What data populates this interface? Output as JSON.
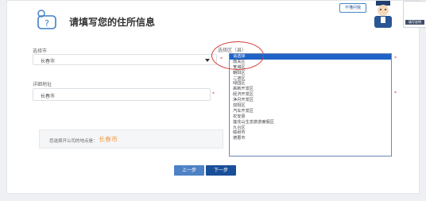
{
  "header": {
    "title": "请填写您的住所信息",
    "icon": "chat-question-icon"
  },
  "mascot": {
    "badge": "不懂问我",
    "sign": "填写说明"
  },
  "city": {
    "label": "选择市",
    "value": "长春市"
  },
  "district": {
    "label": "选择区（县）",
    "options": [
      "请选择",
      "南关区",
      "宽城区",
      "朝阳区",
      "二道区",
      "绿园区",
      "高新开发区",
      "经济开发区",
      "净月开发区",
      "双阳区",
      "汽车开发区",
      "农安县",
      "莲花山生态旅游度假区",
      "九台区",
      "榆树市",
      "德惠市"
    ],
    "selected_index": 0
  },
  "address": {
    "label": "详细地址",
    "value": "长春市"
  },
  "info": {
    "label": "您选择开公司的地点是：",
    "value": "长春市"
  },
  "buttons": {
    "prev": "上一步",
    "next": "下一步"
  },
  "colors": {
    "accent": "#1a4f9a",
    "highlight": "#f0a050",
    "required": "#e0435a",
    "annotation": "#d63b3b"
  }
}
